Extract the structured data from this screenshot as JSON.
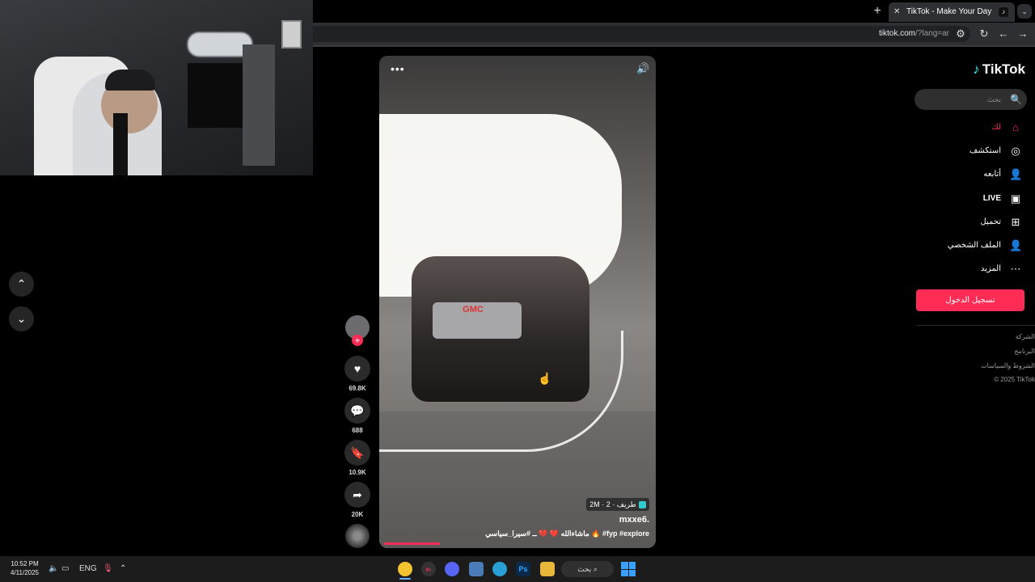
{
  "browser": {
    "new_tab": "+",
    "tab_title": "TikTok - Make Your Day",
    "tab_close": "✕",
    "url_host": "tiktok.com",
    "url_rest": "/?lang=ar",
    "tab_menu": "⌄"
  },
  "tiktok": {
    "brand": "TikTok",
    "search_placeholder": "بحث",
    "nav": [
      {
        "label": "لك",
        "icon": "home-icon"
      },
      {
        "label": "استكشف",
        "icon": "compass-icon"
      },
      {
        "label": "أتابعه",
        "icon": "following-icon"
      },
      {
        "label": "LIVE",
        "icon": "live-icon"
      },
      {
        "label": "تحميل",
        "icon": "upload-icon"
      },
      {
        "label": "الملف الشخصي",
        "icon": "profile-icon"
      },
      {
        "label": "المزيد",
        "icon": "more-icon"
      }
    ],
    "login_label": "تسجيل الدخول",
    "footer": [
      "الشركة",
      "البرنامج",
      "الشروط والسياسات",
      "© 2025 TikTok"
    ],
    "accent_color": "#fe2c55"
  },
  "video": {
    "badge": "2M · طريف · 2",
    "author": "mxxe6.",
    "caption": "ماشاءالله ❤️ 💔 ــ #سيرا_سياسي 🔥 #fyp #explore",
    "progress": 0.21,
    "truck_logo": "GMC",
    "stats": {
      "likes": "69.8K",
      "comments": "688",
      "bookmarks": "10.9K",
      "shares": "20K"
    }
  },
  "taskbar": {
    "time": "10:52 PM",
    "date": "4/11/2025",
    "language": "ENG",
    "search_label": "بحث",
    "notification_badge": "9+"
  }
}
